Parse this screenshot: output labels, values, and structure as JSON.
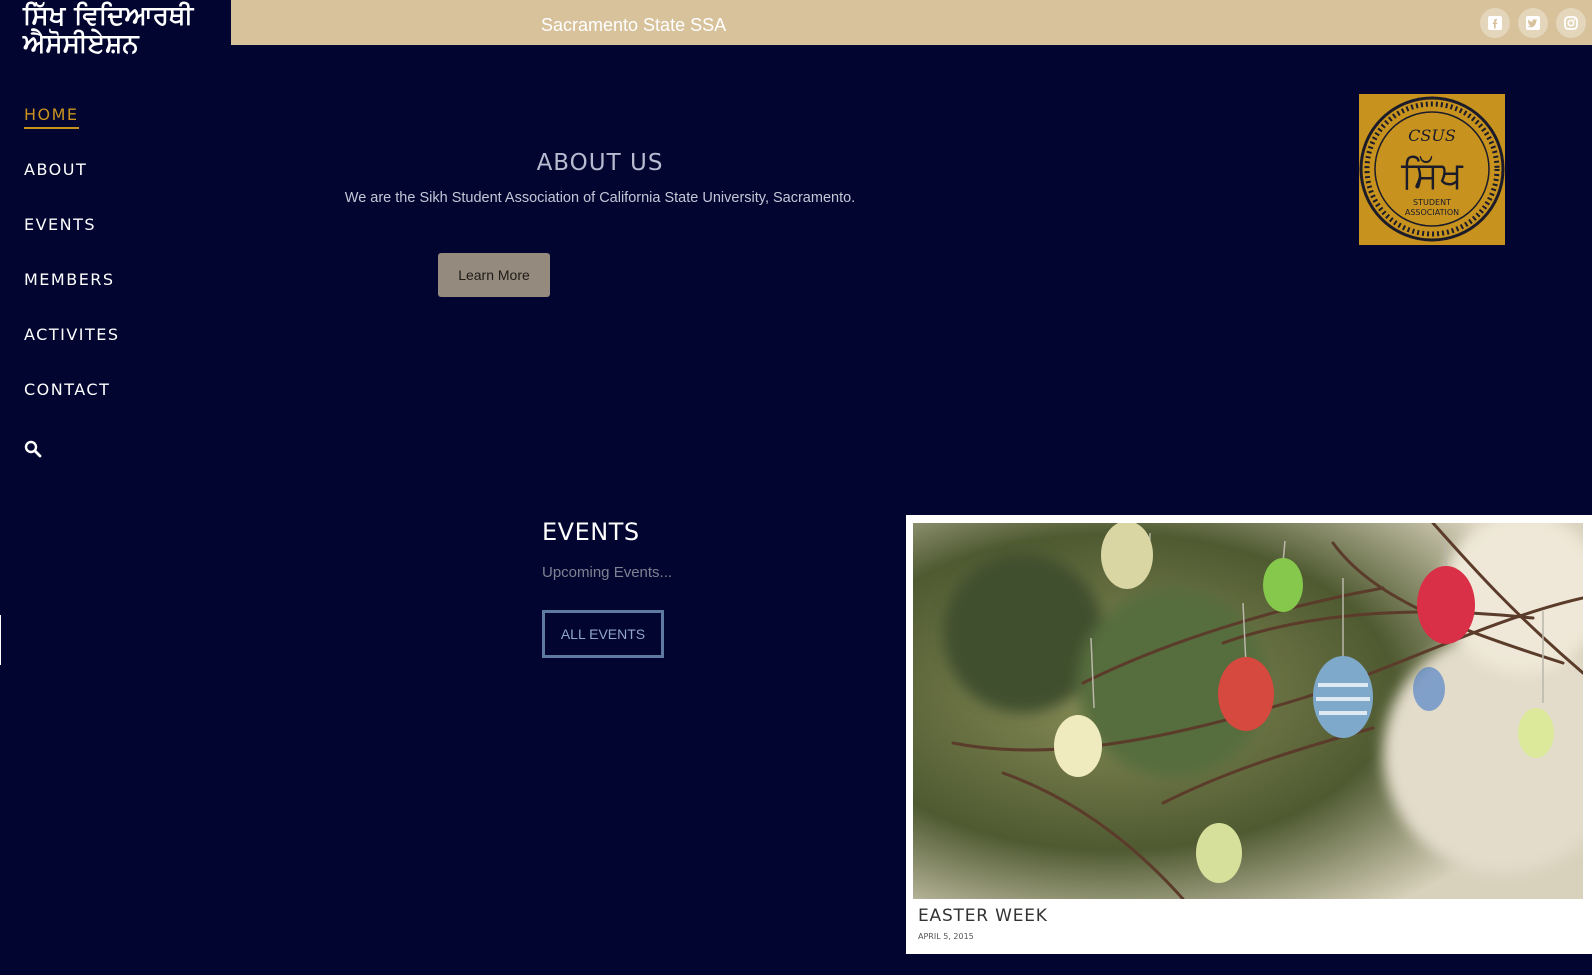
{
  "brand": {
    "name": "ਸਿੱਖ ਵਿਦਿਆਰਥੀ ਐਸੋਸੀਏਸ਼ਨ"
  },
  "header": {
    "site_title": "Sacramento State SSA",
    "social": [
      "facebook-icon",
      "twitter-icon",
      "instagram-icon"
    ]
  },
  "nav": {
    "items": [
      {
        "label": "HOME",
        "active": true
      },
      {
        "label": "ABOUT",
        "active": false
      },
      {
        "label": "EVENTS",
        "active": false
      },
      {
        "label": "MEMBERS",
        "active": false
      },
      {
        "label": "ACTIVITES",
        "active": false
      },
      {
        "label": "CONTACT",
        "active": false
      }
    ],
    "search_icon": "search-icon"
  },
  "about": {
    "title": "ABOUT US",
    "text": "We are the Sikh Student Association of California State University, Sacramento.",
    "button": "Learn More"
  },
  "logo": {
    "line1": "CSUS",
    "script": "ਸਿੱਖ",
    "line2": "STUDENT",
    "line3": "ASSOCIATION"
  },
  "events": {
    "title": "EVENTS",
    "subtitle": "Upcoming Events...",
    "button": "ALL EVENTS",
    "cards": [
      {
        "title": "EASTER WEEK",
        "date": "APRIL 5, 2015"
      }
    ]
  },
  "colors": {
    "background": "#010530",
    "topbar": "#d7c29b",
    "accent": "#c9921d",
    "button": "#948a7e"
  }
}
